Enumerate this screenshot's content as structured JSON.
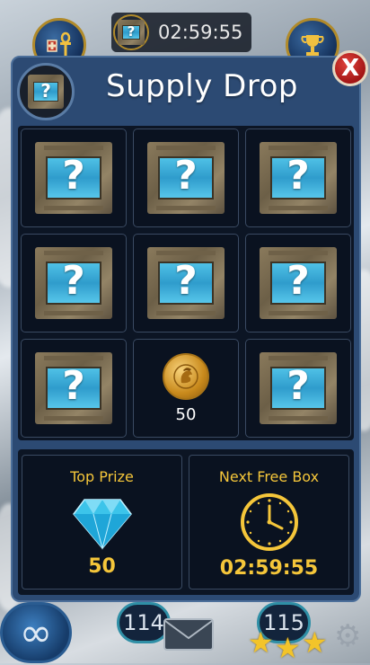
{
  "hud": {
    "timer": "02:59:55",
    "level_left": "114",
    "level_right": "115",
    "star_count": 3
  },
  "dialog": {
    "title": "Supply Drop",
    "close_label": "X",
    "crate_mark": "?",
    "reward": {
      "amount": "50"
    },
    "top_prize": {
      "label": "Top Prize",
      "value": "50"
    },
    "next_free_box": {
      "label": "Next Free Box",
      "value": "02:59:55"
    }
  },
  "colors": {
    "panel": "#2c4a73",
    "gold_text": "#f5c63a",
    "close_red": "#c62a24",
    "crate_blue": "#4fc1e6"
  },
  "icons": [
    "ankh-icon",
    "trophy-icon",
    "crate-icon",
    "coin-icon",
    "diamond-icon",
    "clock-icon",
    "infinity-icon",
    "mail-icon",
    "gear-icon",
    "star-icon"
  ]
}
